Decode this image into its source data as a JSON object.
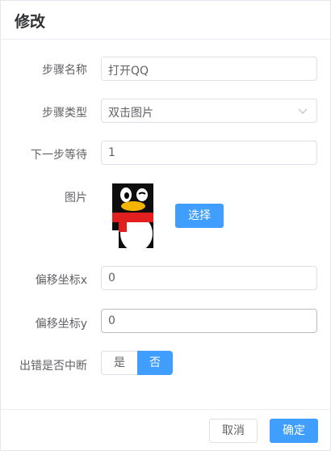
{
  "dialog": {
    "title": "修改"
  },
  "form": {
    "step_name": {
      "label": "步骤名称",
      "value": "打开QQ"
    },
    "step_type": {
      "label": "步骤类型",
      "value": "双击图片"
    },
    "next_wait": {
      "label": "下一步等待",
      "value": "1"
    },
    "image": {
      "label": "图片",
      "select_button": "选择"
    },
    "offset_x": {
      "label": "偏移坐标x",
      "value": "0"
    },
    "offset_y": {
      "label": "偏移坐标y",
      "value": "0"
    },
    "stop_on_error": {
      "label": "出错是否中断",
      "yes": "是",
      "no": "否",
      "selected": "否"
    }
  },
  "footer": {
    "cancel": "取消",
    "confirm": "确定"
  },
  "colors": {
    "primary": "#409eff",
    "border": "#dcdfe6",
    "text": "#606266",
    "title": "#303133"
  },
  "icons": {
    "step_type_dropdown": "chevron-down-icon",
    "image_preview": "qq-penguin-image"
  }
}
